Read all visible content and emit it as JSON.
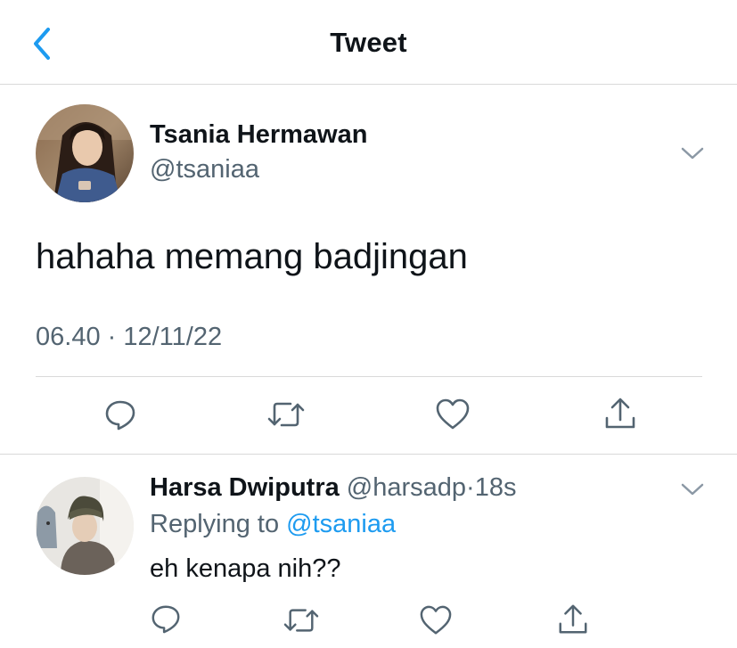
{
  "header": {
    "title": "Tweet",
    "back_icon": "chevron-left-icon",
    "accent_color": "#1d9bf0"
  },
  "tweet": {
    "author_name": "Tsania Hermawan",
    "author_handle": "@tsaniaa",
    "text": "hahaha memang badjingan",
    "timestamp": "06.40 · 12/11/22",
    "actions": [
      "reply-icon",
      "retweet-icon",
      "like-icon",
      "share-icon"
    ]
  },
  "reply": {
    "author_name": "Harsa Dwiputra",
    "author_handle": "@harsadp",
    "separator": "·",
    "time": "18s",
    "replying_prefix": "Replying to",
    "replying_to": "@tsaniaa",
    "text": "eh kenapa nih??",
    "actions": [
      "reply-icon",
      "retweet-icon",
      "like-icon",
      "share-icon"
    ]
  },
  "colors": {
    "text_primary": "#0f1419",
    "text_secondary": "#536471",
    "link": "#1d9bf0",
    "divider": "#d9d9d9"
  }
}
